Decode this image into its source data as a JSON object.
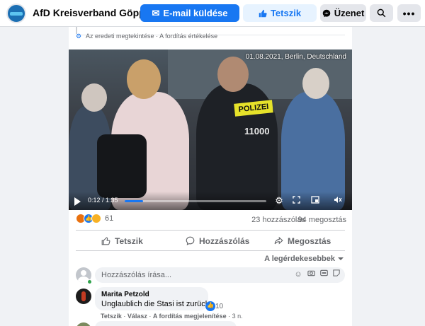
{
  "header": {
    "page_title": "AfD Kreisverband Göppi...",
    "email_button": "E-mail küldése",
    "like_button": "Tetszik",
    "message_button": "Üzenet",
    "more_dots": "•••"
  },
  "post": {
    "translation": {
      "see_original": "Az eredeti megtekintése",
      "separator": "·",
      "rate_translation": "A fordítás értékelése"
    },
    "video": {
      "stamp": "01.08.2021, Berlin, Deutschland",
      "police_label": "POLIZEI",
      "police_number": "11000",
      "time": "0:12 / 1:35",
      "progress": 0.13
    },
    "reactions_count": "61",
    "comments_count": "23 hozzászólás",
    "shares_count": "94 megosztás",
    "actions": {
      "like": "Tetszik",
      "comment": "Hozzászólás",
      "share": "Megosztás"
    },
    "sort_label": "A legérdekesebbek"
  },
  "comment_input": {
    "placeholder": "Hozzászólás írása..."
  },
  "comments": [
    {
      "author": "Marita Petzold",
      "text": "Unglaublich die Stasi ist zurück",
      "reaction_count": "10",
      "like": "Tetszik",
      "reply": "Válasz",
      "see_translation": "A fordítás megjelenítése",
      "age": "3 n."
    }
  ],
  "colors": {
    "brand": "#1877f2",
    "police_yellow": "#e6e22a"
  }
}
